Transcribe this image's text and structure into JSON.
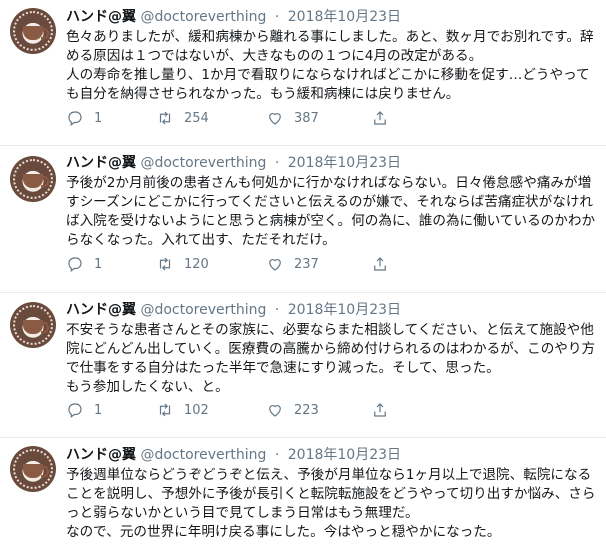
{
  "tweets": [
    {
      "name": "ハンド@翼",
      "handle": "@doctoreverthing",
      "date": "2018年10月23日",
      "text": "色々ありましたが、緩和病棟から離れる事にしました。あと、数ヶ月でお別れです。辞める原因は１つではないが、大きなものの１つに4月の改定がある。\n人の寿命を推し量り、1か月で看取りにならなければどこかに移動を促す…どうやっても自分を納得させられなかった。もう緩和病棟には戻りません。",
      "replies": "1",
      "retweets": "254",
      "likes": "387"
    },
    {
      "name": "ハンド@翼",
      "handle": "@doctoreverthing",
      "date": "2018年10月23日",
      "text": "予後が2か月前後の患者さんも何処かに行かなければならない。日々倦怠感や痛みが増すシーズンにどこかに行ってくださいと伝えるのが嫌で、それならば苦痛症状がなければ入院を受けないようにと思うと病棟が空く。何の為に、誰の為に働いているのかわからなくなった。入れて出す、ただそれだけ。",
      "replies": "1",
      "retweets": "120",
      "likes": "237"
    },
    {
      "name": "ハンド@翼",
      "handle": "@doctoreverthing",
      "date": "2018年10月23日",
      "text": "不安そうな患者さんとその家族に、必要ならまた相談してください、と伝えて施設や他院にどんどん出していく。医療費の高騰から締め付けられるのはわかるが、このやり方で仕事をする自分はたった半年で急速にすり減った。そして、思った。\nもう参加したくない、と。",
      "replies": "1",
      "retweets": "102",
      "likes": "223"
    },
    {
      "name": "ハンド@翼",
      "handle": "@doctoreverthing",
      "date": "2018年10月23日",
      "text": "予後週単位ならどうぞどうぞと伝え、予後が月単位なら1ヶ月以上で退院、転院になることを説明し、予想外に予後が長引くと転院転施設をどうやって切り出すか悩み、さらっと弱らないかという目で見てしまう日常はもう無理だ。\nなので、元の世界に年明け戻る事にした。今はやっと穏やかになった。"
    }
  ],
  "dot": "·",
  "avatar_text": "COFFEE",
  "icons": [
    "reply-icon",
    "retweet-icon",
    "like-icon",
    "share-icon"
  ]
}
